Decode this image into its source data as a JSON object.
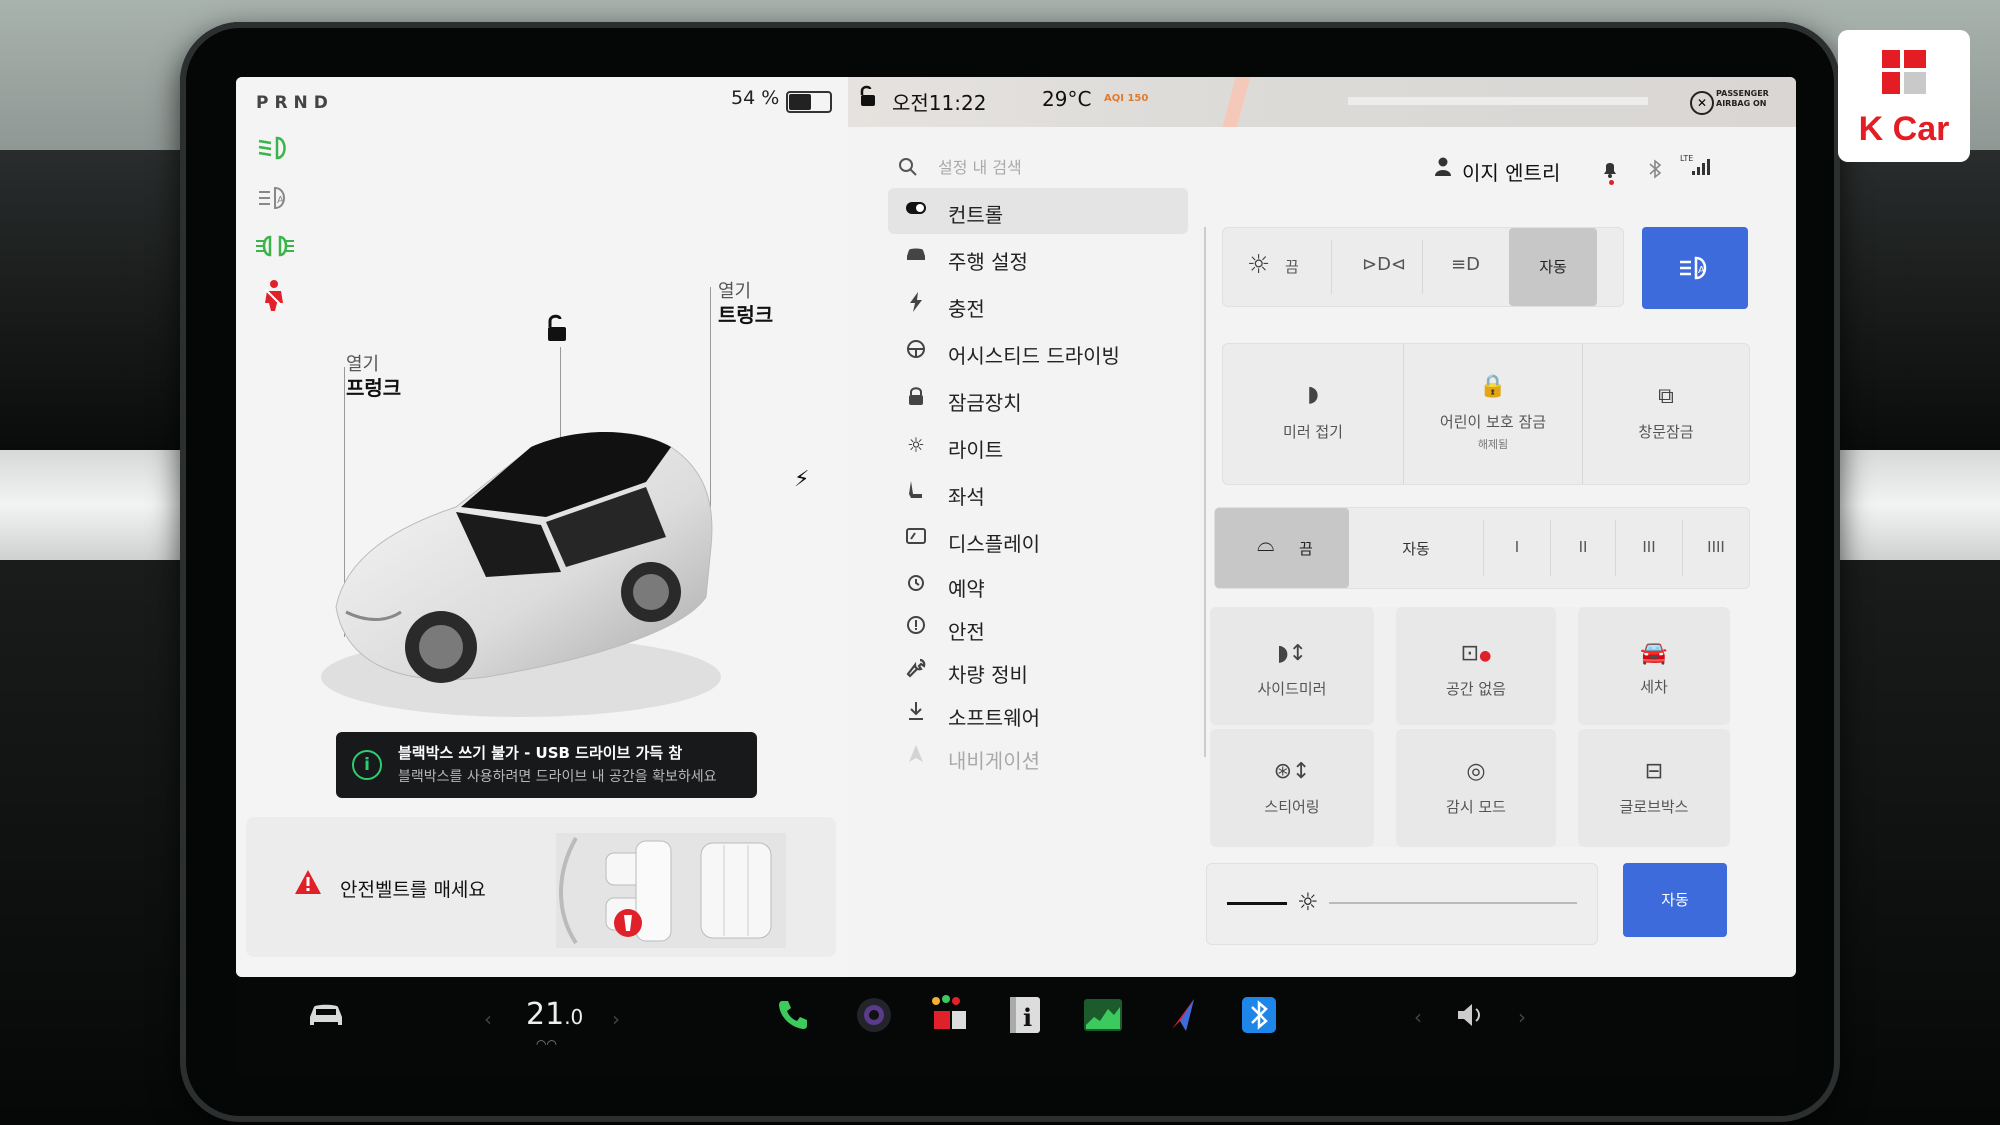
{
  "status": {
    "gear": "PRND",
    "battery_percent": "54 %",
    "battery_level": 0.54,
    "time": "오전11:22",
    "temperature": "29°C",
    "aqi": "AQI 150",
    "airbag": "PASSENGER AIRBAG ON"
  },
  "vehicle": {
    "frunk_small": "열기",
    "frunk_big": "프렁크",
    "trunk_small": "열기",
    "trunk_big": "트렁크",
    "toast_title": "블랙박스 쓰기 불가 - USB 드라이브 가득 참",
    "toast_subtitle": "블랙박스를 사용하려면 드라이브 내 공간을 확보하세요",
    "seatbelt_warning": "안전벨트를 매세요"
  },
  "search": {
    "placeholder": "설정 내 검색"
  },
  "profile": {
    "name": "이지 엔트리"
  },
  "nav": {
    "items": [
      {
        "label": "컨트롤",
        "icon": "toggle-icon"
      },
      {
        "label": "주행 설정",
        "icon": "car-icon"
      },
      {
        "label": "충전",
        "icon": "bolt-icon"
      },
      {
        "label": "어시스티드 드라이빙",
        "icon": "steering-wheel-icon"
      },
      {
        "label": "잠금장치",
        "icon": "lock-icon"
      },
      {
        "label": "라이트",
        "icon": "sun-icon"
      },
      {
        "label": "좌석",
        "icon": "seat-icon"
      },
      {
        "label": "디스플레이",
        "icon": "display-icon"
      },
      {
        "label": "예약",
        "icon": "alarm-icon"
      },
      {
        "label": "안전",
        "icon": "info-icon"
      },
      {
        "label": "차량 정비",
        "icon": "wrench-icon"
      },
      {
        "label": "소프트웨어",
        "icon": "download-icon"
      },
      {
        "label": "내비게이션",
        "icon": "navigation-icon"
      }
    ]
  },
  "controls": {
    "lights": {
      "off": "끔",
      "auto": "자동"
    },
    "row2": {
      "mirror_fold": "미러 접기",
      "child_lock": "어린이 보호 잠금",
      "child_lock_state": "해제됨",
      "window_lock": "창문잠금"
    },
    "wipers": {
      "off": "끔",
      "auto": "자동",
      "speeds": [
        "I",
        "II",
        "III",
        "IIII"
      ]
    },
    "grid": {
      "side_mirror": "사이드미러",
      "no_space": "공간 없음",
      "car_wash": "세차",
      "steering": "스티어링",
      "sentry_mode": "감시 모드",
      "glovebox": "글로브박스"
    },
    "brightness_auto": "자동",
    "brightness_level": 0.1
  },
  "taskbar": {
    "temp_int": "21",
    "temp_dec": ".0"
  },
  "logo": {
    "text": "K Car"
  },
  "colors": {
    "accent_blue": "#3e6bdc",
    "light_green": "#2ecc71",
    "warning_red": "#e0212a",
    "brand_red": "#e41d25"
  }
}
